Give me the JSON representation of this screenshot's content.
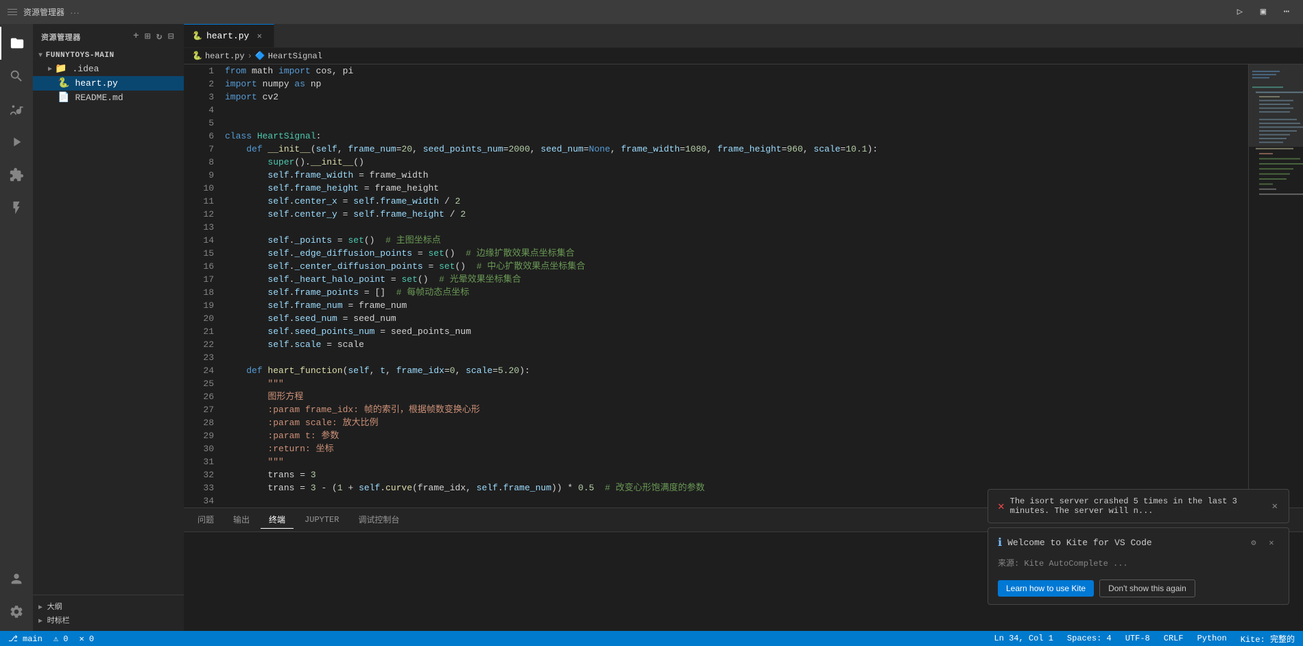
{
  "titlebar": {
    "title": "资源管理器",
    "more_label": "···"
  },
  "activity": {
    "icons": [
      {
        "name": "explorer-icon",
        "symbol": "⎘",
        "active": true,
        "label": "资源管理器"
      },
      {
        "name": "search-icon",
        "symbol": "🔍",
        "active": false,
        "label": "搜索"
      },
      {
        "name": "source-control-icon",
        "symbol": "⑂",
        "active": false,
        "label": "源代码管理"
      },
      {
        "name": "run-icon",
        "symbol": "▷",
        "active": false,
        "label": "运行"
      },
      {
        "name": "extensions-icon",
        "symbol": "⊞",
        "active": false,
        "label": "扩展"
      },
      {
        "name": "test-icon",
        "symbol": "⚗",
        "active": false,
        "label": "测试"
      },
      {
        "name": "account-icon",
        "symbol": "👤",
        "label": "账户"
      },
      {
        "name": "settings-icon",
        "symbol": "⚙",
        "label": "设置"
      }
    ]
  },
  "sidebar": {
    "header": "资源管理器",
    "project": {
      "name": "FUNNYTOYS-MAIN",
      "items": [
        {
          "name": ".idea",
          "type": "folder",
          "icon": "▶"
        },
        {
          "name": "heart.py",
          "type": "file-py",
          "active": true
        },
        {
          "name": "README.md",
          "type": "file-md"
        }
      ]
    },
    "footer_items": [
      {
        "label": "大纲"
      },
      {
        "label": "时标栏"
      }
    ]
  },
  "tabs": [
    {
      "label": "heart.py",
      "type": "py",
      "active": true,
      "icon": "🐍"
    }
  ],
  "breadcrumb": {
    "file": "heart.py",
    "class": "HeartSignal"
  },
  "code": {
    "lines": [
      {
        "num": 1,
        "content": "from math import cos, pi"
      },
      {
        "num": 2,
        "content": "import numpy as np"
      },
      {
        "num": 3,
        "content": "import cv2"
      },
      {
        "num": 4,
        "content": ""
      },
      {
        "num": 5,
        "content": ""
      },
      {
        "num": 6,
        "content": "class HeartSignal:"
      },
      {
        "num": 7,
        "content": "    def __init__(self, frame_num=20, seed_points_num=2000, seed_num=None, frame_width=1080, frame_height=960, scale=10.1):"
      },
      {
        "num": 8,
        "content": "        super().__init__()"
      },
      {
        "num": 9,
        "content": "        self.frame_width = frame_width"
      },
      {
        "num": 10,
        "content": "        self.frame_height = frame_height"
      },
      {
        "num": 11,
        "content": "        self.center_x = self.frame_width / 2"
      },
      {
        "num": 12,
        "content": "        self.center_y = self.frame_height / 2"
      },
      {
        "num": 13,
        "content": ""
      },
      {
        "num": 14,
        "content": "        self._points = set()  # 主图坐标点"
      },
      {
        "num": 15,
        "content": "        self._edge_diffusion_points = set()  # 边缘扩散效果点坐标集合"
      },
      {
        "num": 16,
        "content": "        self._center_diffusion_points = set()  # 中心扩散效果点坐标集合"
      },
      {
        "num": 17,
        "content": "        self._heart_halo_point = set()  # 光晕效果坐标集合"
      },
      {
        "num": 18,
        "content": "        self.frame_points = []  # 每帧动态点坐标"
      },
      {
        "num": 19,
        "content": "        self.frame_num = frame_num"
      },
      {
        "num": 20,
        "content": "        self.seed_num = seed_num"
      },
      {
        "num": 21,
        "content": "        self.seed_points_num = seed_points_num"
      },
      {
        "num": 22,
        "content": "        self.scale = scale"
      },
      {
        "num": 23,
        "content": ""
      },
      {
        "num": 24,
        "content": "    def heart_function(self, t, frame_idx=0, scale=5.20):"
      },
      {
        "num": 25,
        "content": "        \"\"\""
      },
      {
        "num": 26,
        "content": "        图形方程"
      },
      {
        "num": 27,
        "content": "        :param frame_idx: 帧的索引，根据帧数变换心形"
      },
      {
        "num": 28,
        "content": "        :param scale: 放大比例"
      },
      {
        "num": 29,
        "content": "        :param t: 参数"
      },
      {
        "num": 30,
        "content": "        :return: 坐标"
      },
      {
        "num": 31,
        "content": "        \"\"\""
      },
      {
        "num": 32,
        "content": "        trans = 3"
      },
      {
        "num": 33,
        "content": "        trans = 3 - (1 + self.curve(frame_idx, self.frame_num)) * 0.5  # 改变心形饱满度的参数"
      },
      {
        "num": 34,
        "content": ""
      }
    ]
  },
  "terminal": {
    "tabs": [
      {
        "label": "问题",
        "active": false
      },
      {
        "label": "输出",
        "active": false
      },
      {
        "label": "终端",
        "active": true
      },
      {
        "label": "JUPYTER",
        "active": false
      },
      {
        "label": "调试控制台",
        "active": false
      }
    ],
    "content": ""
  },
  "notifications": {
    "error": {
      "icon": "✕",
      "text": "The isort server crashed 5 times in the last 3 minutes. The server will n..."
    },
    "kite": {
      "icon": "ℹ",
      "title": "Welcome to Kite for VS Code",
      "source": "来源: Kite AutoComplete ...",
      "buttons": [
        {
          "label": "Learn how to use Kite",
          "type": "primary"
        },
        {
          "label": "Don't show this again",
          "type": "secondary"
        }
      ],
      "controls": [
        {
          "name": "gear-icon",
          "symbol": "⚙"
        },
        {
          "name": "close-icon",
          "symbol": "✕"
        }
      ]
    }
  },
  "statusbar": {
    "left": [
      "⎇ main",
      "⚠ 0",
      "✕ 0"
    ],
    "right": [
      "Ln 34, Col 1",
      "Spaces: 4",
      "UTF-8",
      "CRLF",
      "Python",
      "Kite: 完整的"
    ]
  }
}
